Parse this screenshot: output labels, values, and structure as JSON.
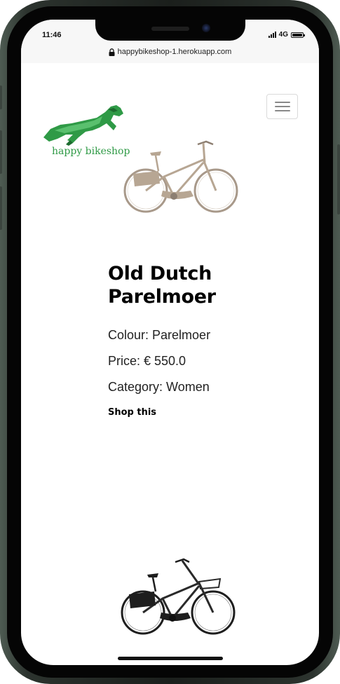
{
  "status_bar": {
    "time": "11:46",
    "network": "4G"
  },
  "browser": {
    "url": "happybikeshop-1.herokuapp.com"
  },
  "header": {
    "logo_text": "happy bikeshop",
    "menu_icon": "hamburger-menu-icon"
  },
  "product": {
    "title_line1": "Old Dutch",
    "title_line2": "Parelmoer",
    "colour": "Colour: Parelmoer",
    "price": "Price: € 550.0",
    "category": "Category: Women",
    "shop_link": "Shop this"
  },
  "colors": {
    "logo_green": "#2f9a46",
    "bike_beige": "#b7a693",
    "bike_black": "#1e1e1e"
  }
}
